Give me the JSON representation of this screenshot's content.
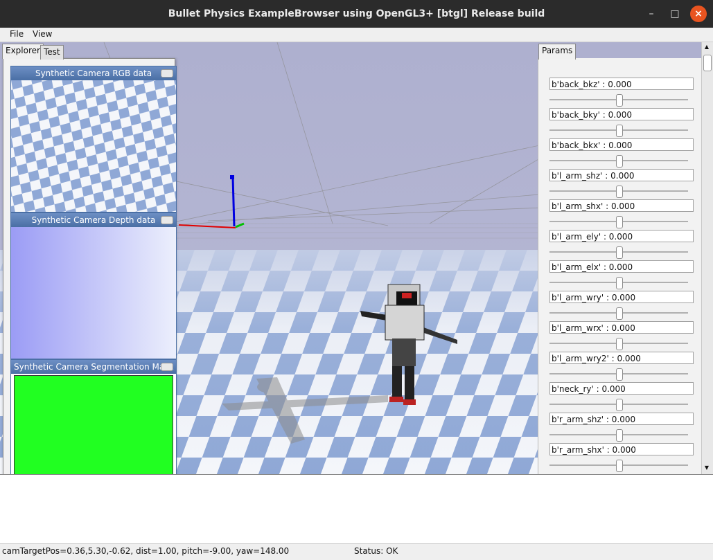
{
  "window": {
    "title": "Bullet Physics ExampleBrowser using OpenGL3+ [btgl] Release build"
  },
  "menu": {
    "items": [
      "File",
      "View"
    ]
  },
  "left_tabs": [
    "Explorer",
    "Test"
  ],
  "camera_windows": [
    {
      "title": "Synthetic Camera RGB data"
    },
    {
      "title": "Synthetic Camera Depth data"
    },
    {
      "title": "Synthetic Camera Segmentation Mask"
    }
  ],
  "params": {
    "tab": "Params",
    "items": [
      {
        "label": "b'back_bkz'  : 0.000",
        "value": 0.5
      },
      {
        "label": "b'back_bky'  : 0.000",
        "value": 0.5
      },
      {
        "label": "b'back_bkx'  : 0.000",
        "value": 0.5
      },
      {
        "label": "b'l_arm_shz'  : 0.000",
        "value": 0.5
      },
      {
        "label": "b'l_arm_shx'  : 0.000",
        "value": 0.5
      },
      {
        "label": "b'l_arm_ely'  : 0.000",
        "value": 0.5
      },
      {
        "label": "b'l_arm_elx'  : 0.000",
        "value": 0.5
      },
      {
        "label": "b'l_arm_wry'  : 0.000",
        "value": 0.5
      },
      {
        "label": "b'l_arm_wrx'  : 0.000",
        "value": 0.5
      },
      {
        "label": "b'l_arm_wry2'  : 0.000",
        "value": 0.5
      },
      {
        "label": "b'neck_ry'  : 0.000",
        "value": 0.5
      },
      {
        "label": "b'r_arm_shz'  : 0.000",
        "value": 0.5
      },
      {
        "label": "b'r_arm_shx'  : 0.000",
        "value": 0.5
      }
    ]
  },
  "statusbar": {
    "camera": "camTargetPos=0.36,5.30,-0.62, dist=1.00, pitch=-9.00, yaw=148.00",
    "status": "Status: OK"
  },
  "colors": {
    "sky": "#b3b3d1",
    "checker_blue": "#8fa8d6",
    "checker_white": "#f4f6fa",
    "segmentation": "#21ff21",
    "depth_start": "#9b9cf5",
    "depth_end": "#eceffc"
  }
}
